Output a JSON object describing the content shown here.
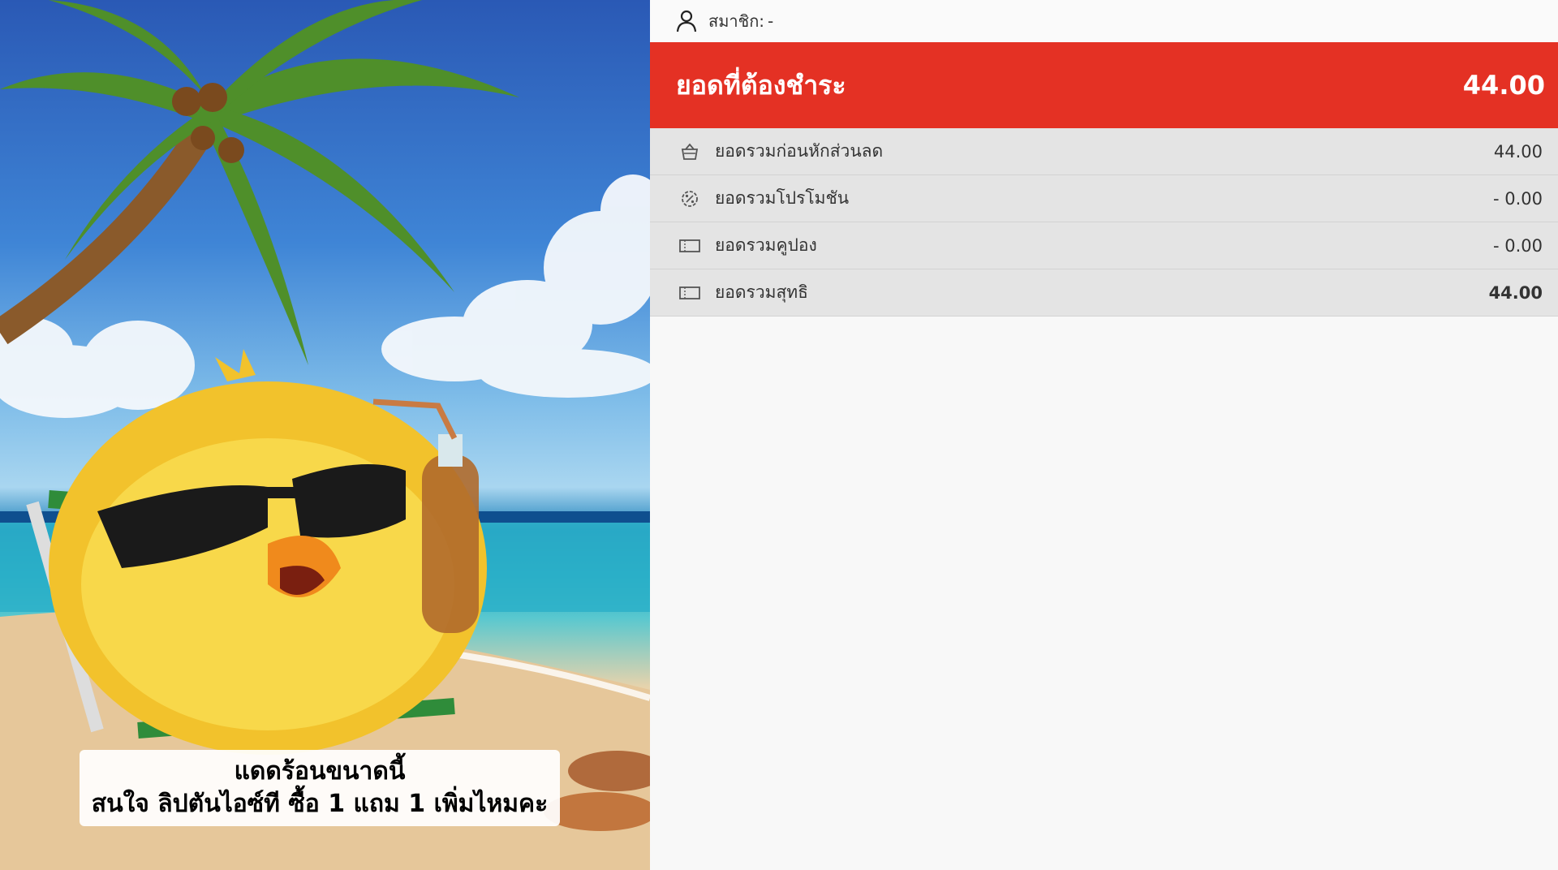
{
  "member": {
    "label": "สมาชิก:",
    "value": "-",
    "icon": "user-icon"
  },
  "total_due": {
    "label": "ยอดที่ต้องชำระ",
    "amount": "44.00"
  },
  "summary_rows": [
    {
      "icon": "basket-icon",
      "label": "ยอดรวมก่อนหักส่วนลด",
      "value": "44.00"
    },
    {
      "icon": "percent-badge-icon",
      "label": "ยอดรวมโปรโมชัน",
      "value": "- 0.00"
    },
    {
      "icon": "coupon-icon",
      "label": "ยอดรวมคูปอง",
      "value": "- 0.00"
    },
    {
      "icon": "coupon-icon",
      "label": "ยอดรวมสุทธิ",
      "value": "44.00"
    }
  ],
  "promo": {
    "caption_line1": "แดดร้อนขนาดนี้",
    "caption_line2": "สนใจ ลิปตันไอซ์ที ซื้อ 1 แถม 1 เพิ่มไหมคะ"
  },
  "colors": {
    "accent_red": "#e43124",
    "row_bg": "#e4e4e4",
    "page_bg": "#f8f8f8"
  }
}
